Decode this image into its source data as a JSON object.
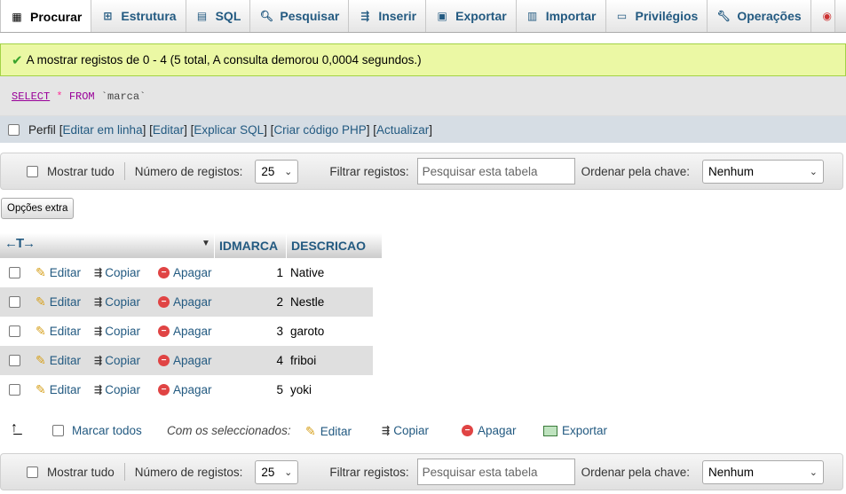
{
  "tabs": [
    {
      "label": "Procurar",
      "icon": "browse-icon",
      "active": true
    },
    {
      "label": "Estrutura",
      "icon": "structure-icon"
    },
    {
      "label": "SQL",
      "icon": "sql-icon"
    },
    {
      "label": "Pesquisar",
      "icon": "search-icon"
    },
    {
      "label": "Inserir",
      "icon": "insert-icon"
    },
    {
      "label": "Exportar",
      "icon": "export-icon"
    },
    {
      "label": "Importar",
      "icon": "import-icon"
    },
    {
      "label": "Privilégios",
      "icon": "privileges-icon"
    },
    {
      "label": "Operações",
      "icon": "operations-icon"
    }
  ],
  "success_message": "A mostrar registos de 0 - 4 (5 total, A consulta demorou 0,0004 segundos.)",
  "sql": {
    "select": "SELECT",
    "star": "*",
    "from": "FROM",
    "table": "`marca`"
  },
  "profile": {
    "label": "Perfil",
    "links": [
      "Editar em linha",
      "Editar",
      "Explicar SQL",
      "Criar código PHP",
      "Actualizar"
    ]
  },
  "navbar": {
    "show_all": "Mostrar tudo",
    "rows_label": "Número de registos:",
    "rows_value": "25",
    "filter_label": "Filtrar registos:",
    "filter_placeholder": "Pesquisar esta tabela",
    "sort_label": "Ordenar pela chave:",
    "sort_value": "Nenhum"
  },
  "extra_options": "Opções extra",
  "table": {
    "columns": [
      "IDMARCA",
      "DESCRICAO"
    ],
    "actions": {
      "edit": "Editar",
      "copy": "Copiar",
      "delete": "Apagar"
    },
    "rows": [
      {
        "id": "1",
        "desc": "Native"
      },
      {
        "id": "2",
        "desc": "Nestle"
      },
      {
        "id": "3",
        "desc": "garoto"
      },
      {
        "id": "4",
        "desc": "friboi"
      },
      {
        "id": "5",
        "desc": "yoki"
      }
    ]
  },
  "bulk": {
    "select_all": "Marcar todos",
    "with_selected": "Com os seleccionados:",
    "edit": "Editar",
    "copy": "Copiar",
    "delete": "Apagar",
    "export": "Exportar"
  }
}
